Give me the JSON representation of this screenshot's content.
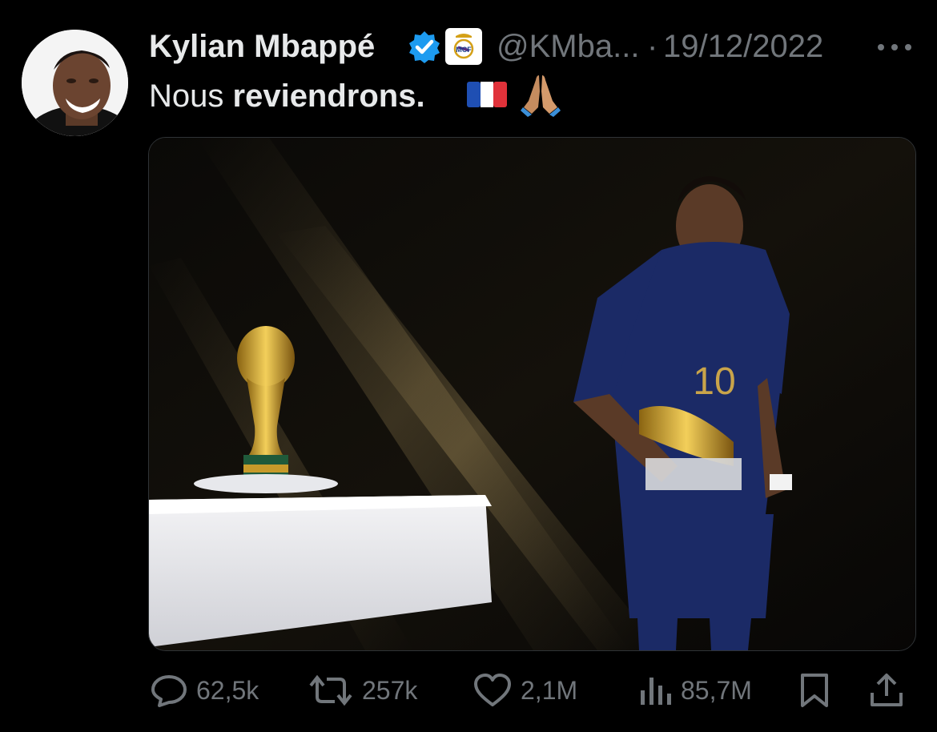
{
  "tweet": {
    "author_name": "Kylian Mbappé",
    "handle": "@KMba...",
    "separator": "·",
    "date": "19/12/2022",
    "text_plain": "Nous",
    "text_bold": "reviendrons.",
    "verified_color": "#1d9bf0",
    "avatar_icon": "profile-photo-avatar",
    "badge_icon": "real-madrid-crest-icon",
    "emojis": [
      "france-flag-emoji",
      "folded-hands-emoji"
    ]
  },
  "media": {
    "description_icon": "tweet-photo"
  },
  "actions": {
    "replies": "62,5k",
    "retweets": "257k",
    "likes": "2,1M",
    "views": "85,7M"
  },
  "colors": {
    "background": "#000000",
    "text": "#e7e9ea",
    "muted": "#71767b",
    "accent": "#1d9bf0"
  }
}
